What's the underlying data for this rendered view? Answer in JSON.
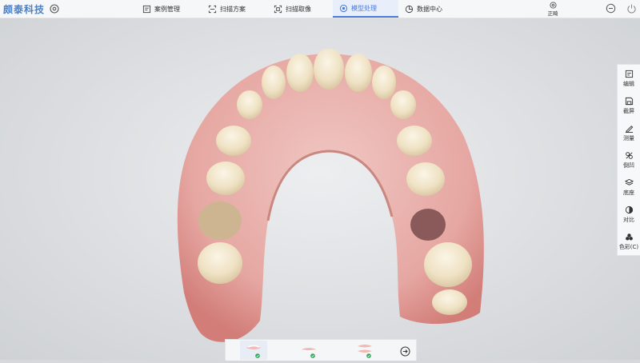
{
  "app": {
    "logo_text": "颇泰科技",
    "accent_color": "#4a7bd8"
  },
  "tabs": [
    {
      "label": "案例管理",
      "icon": "case-icon",
      "active": false
    },
    {
      "label": "扫描方案",
      "icon": "scan-plan-icon",
      "active": false
    },
    {
      "label": "扫描取像",
      "icon": "scan-capture-icon",
      "active": false
    },
    {
      "label": "模型处理",
      "icon": "model-process-icon",
      "active": true
    },
    {
      "label": "数据中心",
      "icon": "data-center-icon",
      "active": false
    }
  ],
  "view_controls": {
    "orient_label": "正畸"
  },
  "right_toolbar": [
    {
      "label": "编辑",
      "icon": "edit-icon"
    },
    {
      "label": "截屏",
      "icon": "screenshot-icon"
    },
    {
      "label": "测量",
      "icon": "measure-icon"
    },
    {
      "label": "倒凹",
      "icon": "undercut-icon"
    },
    {
      "label": "底座",
      "icon": "base-icon"
    },
    {
      "label": "对比",
      "icon": "contrast-icon"
    },
    {
      "label": "色彩(C)",
      "icon": "color-icon"
    }
  ],
  "bottom_strip": {
    "thumbnails": [
      {
        "icon": "upper-jaw-thumbnail-icon",
        "status": "check-icon",
        "selected": true
      },
      {
        "icon": "lower-jaw-thumbnail-icon",
        "status": "check-icon",
        "selected": false
      },
      {
        "icon": "bite-thumbnail-icon",
        "status": "check-icon",
        "selected": false
      }
    ],
    "next_icon": "arrow-right-circle-icon"
  }
}
